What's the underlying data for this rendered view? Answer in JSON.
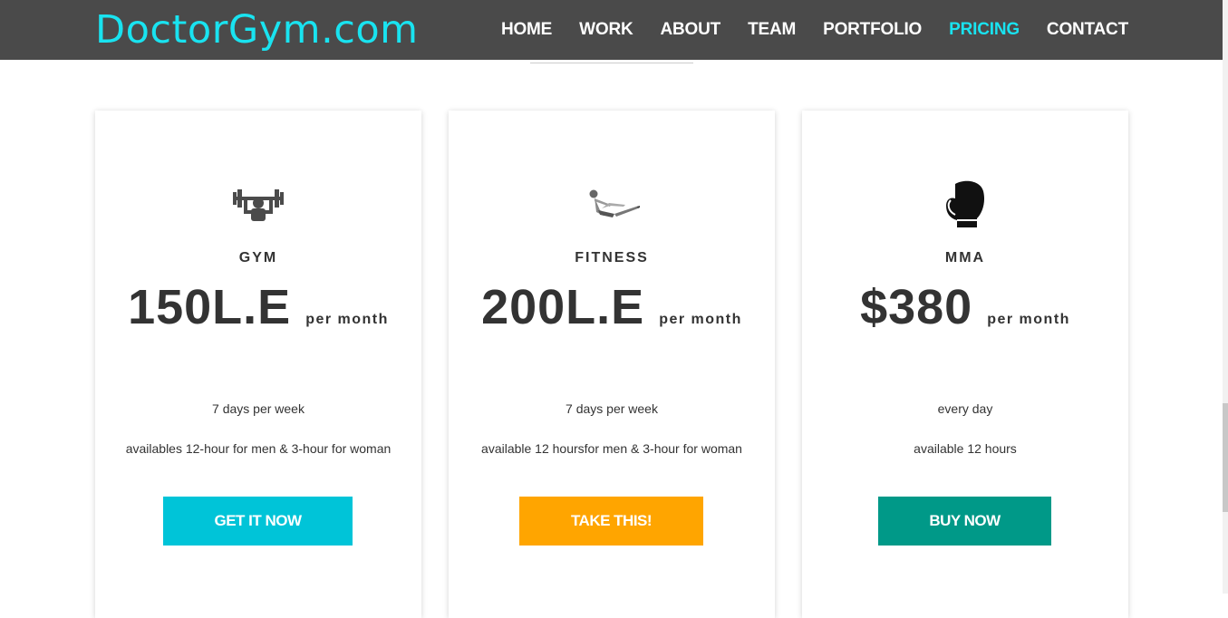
{
  "brand": "DoctorGym.com",
  "nav": [
    {
      "label": "HOME",
      "active": false
    },
    {
      "label": "WORK",
      "active": false
    },
    {
      "label": "ABOUT",
      "active": false
    },
    {
      "label": "TEAM",
      "active": false
    },
    {
      "label": "PORTFOLIO",
      "active": false
    },
    {
      "label": "PRICING",
      "active": true
    },
    {
      "label": "CONTACT",
      "active": false
    }
  ],
  "plans": [
    {
      "icon": "weightlifting-icon",
      "name": "GYM",
      "price": "150L.E",
      "period": "per month",
      "feature1": "7 days per week",
      "feature2": "availables 12-hour for men & 3-hour for woman",
      "button": "GET IT NOW",
      "button_color": "#00c4d8"
    },
    {
      "icon": "situp-icon",
      "name": "FITNESS",
      "price": "200L.E",
      "period": "per month",
      "feature1": "7 days per week",
      "feature2": "available 12 hoursfor men & 3-hour for woman",
      "button": "TAKE THIS!",
      "button_color": "#ffa500"
    },
    {
      "icon": "boxing-glove-icon",
      "name": "MMA",
      "price": "$380",
      "period": "per month",
      "feature1": "every day",
      "feature2": "available 12 hours",
      "button": "BUY NOW",
      "button_color": "#009988"
    }
  ]
}
